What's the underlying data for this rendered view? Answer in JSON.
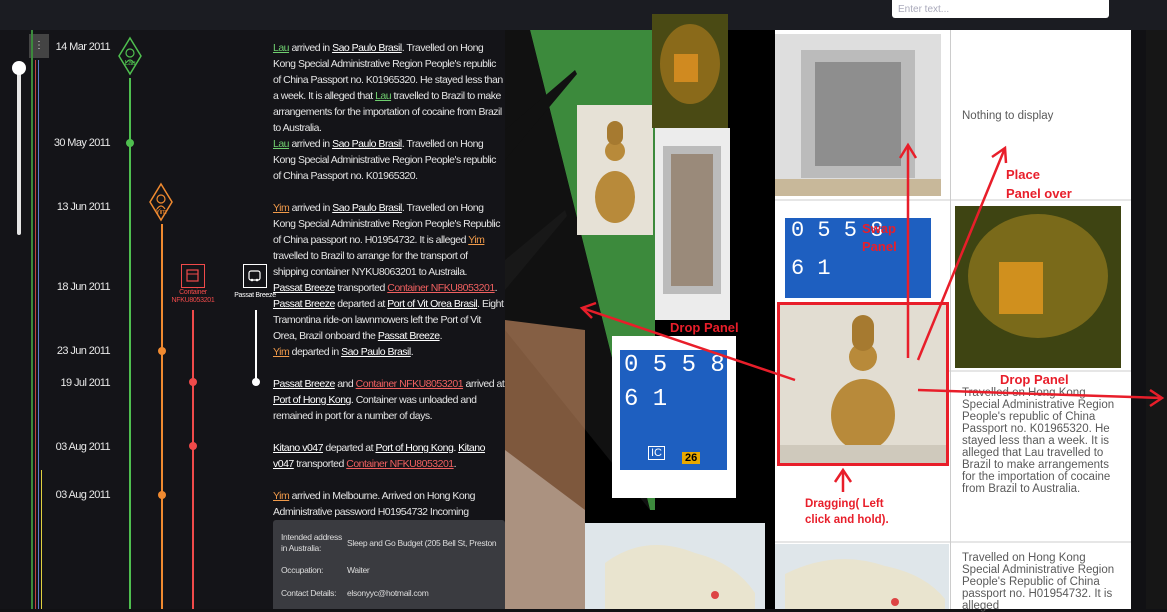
{
  "search": {
    "placeholder": "Enter text..."
  },
  "timeline": {
    "scroll_label": "⋮",
    "dates": [
      "14 Mar 2011",
      "30 May 2011",
      "13 Jun 2011",
      "18 Jun 2011",
      "23 Jun 2011",
      "19 Jul 2011",
      "03 Aug 2011",
      "03 Aug 2011"
    ],
    "lanes": {
      "lau": {
        "label": "Lau",
        "color": "#4fbf4f"
      },
      "yim": {
        "label": "Yim",
        "color": "#f08a30"
      },
      "container": {
        "label": "Container NFKU8053201",
        "color": "#f04a4a"
      },
      "passat": {
        "label": "Passat Breeze",
        "color": "#ffffff"
      }
    },
    "events": {
      "e1": {
        "a": "Lau",
        "b": " arrived in ",
        "c": "Sao Paulo Brasil",
        "d": ". Travelled on Hong Kong Special Administrative Region People's republic of China Passport no. K01965320. He stayed less than a week. It is alleged that ",
        "e": "Lau",
        "f": " travelled to Brazil to make arrangements for the importation of cocaine from Brazil to Australia."
      },
      "e2": {
        "a": "Lau",
        "b": " arrived in ",
        "c": "Sao Paulo Brasil",
        "d": ". Travelled on Hong Kong Special Administrative Region People's republic of China Passport no. K01965320."
      },
      "e3": {
        "a": "Yim",
        "b": " arrived in ",
        "c": "Sao Paulo Brasil",
        "d": ". Travelled on Hong Kong Special Administrative Region People's Republic of China passport no. H01954732. It is alleged ",
        "e": "Yim",
        "f": " travelled to Brazil to arrange for the transport of shipping container NYKU8063201 to Austraila."
      },
      "e4": {
        "a": "Passat Breeze",
        "b": " transported ",
        "c": "Container NFKU8053201",
        "d": ". ",
        "e": "Passat Breeze",
        "f": " departed at ",
        "g": "Port of Vit Orea Brasil",
        "h": ". Eight Tramontina ride-on lawnmowers left the Port of Vit Orea, Brazil onboard the ",
        "i": "Passat Breeze",
        "j": "."
      },
      "e5": {
        "a": "Yim",
        "b": " departed in ",
        "c": "Sao Paulo Brasil",
        "d": "."
      },
      "e6": {
        "a": "Passat Breeze",
        "b": " and ",
        "c": "Container NFKU8053201",
        "d": " arrived at ",
        "e": "Port of Hong Kong",
        "f": ". Container was unloaded and remained in port for a number of days."
      },
      "e7": {
        "a": "Kitano v047",
        "b": " departed at ",
        "c": "Port of Hong Kong",
        "d": ". ",
        "e": "Kitano v047",
        "f": " transported ",
        "g": "Container NFKU8053201",
        "h": "."
      },
      "e8": {
        "a": "Yim",
        "b": " arrived in Melbourne. Arrived on Hong Kong Administrative password H01954732 Incoming passenger card shows:"
      }
    },
    "card": {
      "address_label": "Intended address in Australia:",
      "address_value": "Sleep and Go Budget (205 Bell St, Preston",
      "occupation_label": "Occupation:",
      "occupation_value": "Waiter",
      "contact_label": "Contact Details:",
      "contact_value": "elsonyyc@hotmail.com"
    }
  },
  "grid": {
    "nothing": "Nothing to display",
    "text_lau": "Travelled on Hong Kong Special Administrative Region People's republic of China Passport no. K01965320. He stayed less than a week. It is alleged that Lau travelled to Brazil to make arrangements for the importation of cocaine from Brazil to Australia.",
    "text_yim": "Travelled on Hong Kong Special Administrative Region People's Republic of China passport no. H01954732. It is alleged"
  },
  "container_digits": {
    "row1": "0 5 5 8",
    "row2": "6 1",
    "tag": "26",
    "tag2": "IC"
  },
  "annotations": {
    "place_over": "Place\nPanel over",
    "swap": "Swap\nPanel",
    "drop_left": "Drop Panel",
    "drop_right": "Drop Panel",
    "dragging": "Dragging( Left\nclick and hold)."
  },
  "colors": {
    "annotation": "#e81e2a",
    "lau": "#4fbf4f",
    "yim": "#f08a30",
    "container": "#f04a4a"
  }
}
